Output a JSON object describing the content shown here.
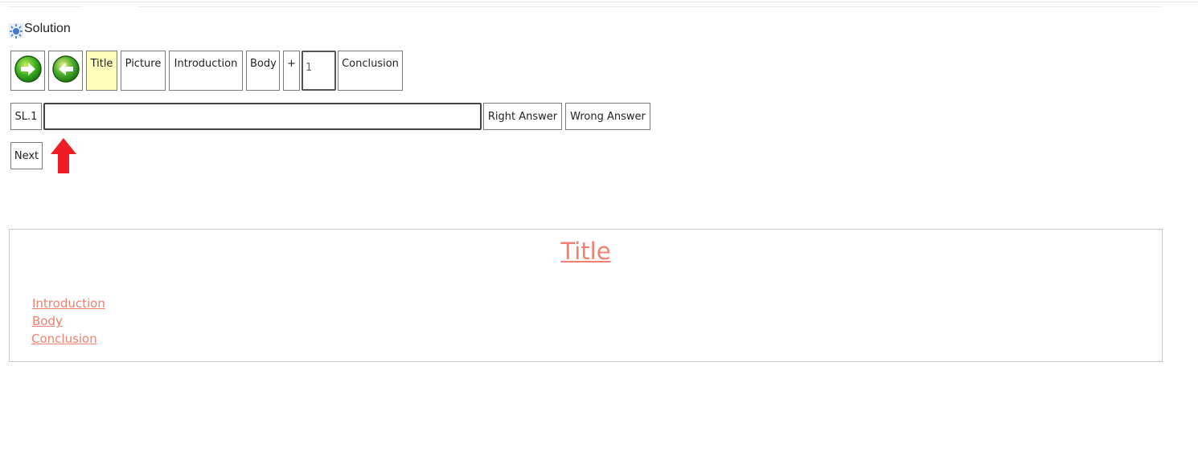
{
  "header": {
    "solution_label": "Solution",
    "solution_icon": "sun-icon"
  },
  "toolbar": {
    "forward_icon": "arrow-right-circle-icon",
    "back_icon": "arrow-left-circle-icon",
    "tabs": [
      {
        "label": "Title",
        "selected": true
      },
      {
        "label": "Picture",
        "selected": false
      },
      {
        "label": "Introduction",
        "selected": false
      },
      {
        "label": "Body",
        "selected": false
      },
      {
        "label": "+",
        "selected": false
      },
      {
        "label": "Conclusion",
        "selected": false
      }
    ],
    "body_count_value": "1"
  },
  "answer_row": {
    "slide_label": "SL.1",
    "answer_value": "",
    "right_answer_label": "Right Answer",
    "wrong_answer_label": "Wrong Answer"
  },
  "next_label": "Next",
  "annotation": {
    "arrow_icon": "red-up-arrow-icon",
    "arrow_color": "#ee1c24"
  },
  "preview": {
    "title": "Title",
    "links": [
      "Introduction",
      "Body",
      "Conclusion"
    ],
    "link_color": "#f08070"
  }
}
